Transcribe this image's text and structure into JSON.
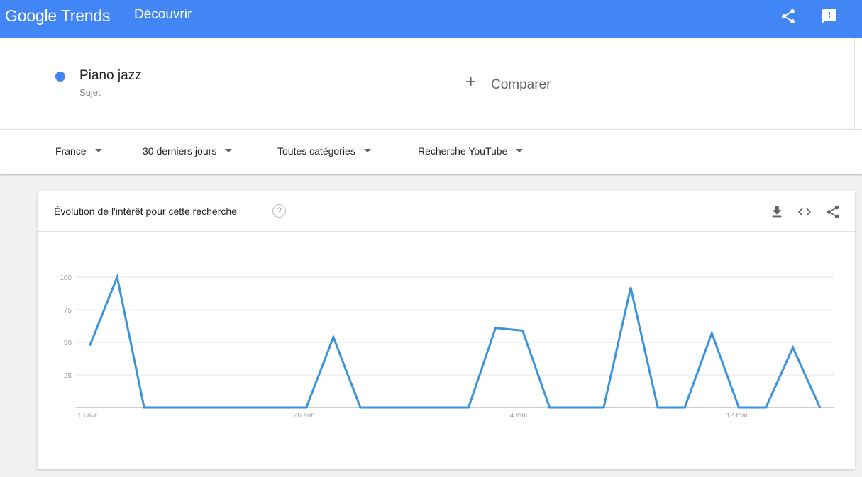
{
  "header": {
    "brand_google": "Google",
    "brand_trends": "Trends",
    "nav_label": "Découvrir",
    "icons": [
      "share-icon",
      "feedback-icon"
    ]
  },
  "term": {
    "name": "Piano jazz",
    "type": "Sujet",
    "color": "#4285f4"
  },
  "compare": {
    "plus": "+",
    "label": "Comparer"
  },
  "filters": {
    "region": "France",
    "period": "30 derniers jours",
    "category": "Toutes catégories",
    "source": "Recherche YouTube"
  },
  "card": {
    "title": "Évolution de l'intérêt pour cette recherche",
    "help": "?",
    "icons": [
      "download-icon",
      "embed-code-icon",
      "share-icon"
    ]
  },
  "chart_data": {
    "type": "line",
    "title": "",
    "xlabel": "",
    "ylabel": "",
    "ylim": [
      0,
      100
    ],
    "y_ticks": [
      "25",
      "50",
      "75",
      "100"
    ],
    "x_tick_labels": [
      {
        "label": "18 avr.",
        "day_index": 0
      },
      {
        "label": "26 avr.",
        "day_index": 8
      },
      {
        "label": "4 mai",
        "day_index": 16
      },
      {
        "label": "12 mai",
        "day_index": 24
      }
    ],
    "grid": true,
    "series": [
      {
        "color": "#3b93dc",
        "values": [
          48,
          100,
          0,
          0,
          0,
          0,
          0,
          0,
          0,
          54,
          0,
          0,
          0,
          0,
          0,
          61,
          59,
          0,
          0,
          0,
          92,
          0,
          0,
          57,
          0,
          0,
          46,
          0
        ]
      }
    ]
  }
}
